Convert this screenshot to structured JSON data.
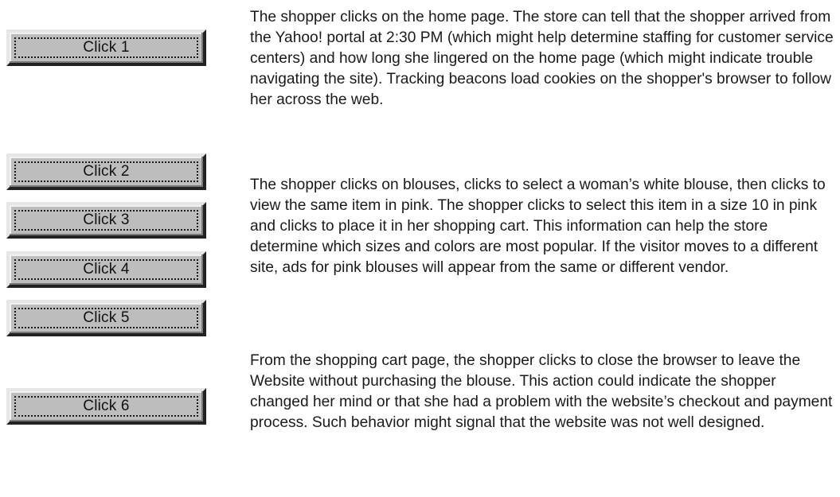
{
  "clicks": [
    {
      "label": "Click 1"
    },
    {
      "label": "Click 2"
    },
    {
      "label": "Click 3"
    },
    {
      "label": "Click 4"
    },
    {
      "label": "Click 5"
    },
    {
      "label": "Click 6"
    }
  ],
  "descriptions": [
    {
      "text": "The shopper clicks on the home page. The store can tell that the shopper arrived from the Yahoo! portal at 2:30 PM (which might help determine staffing for customer service centers) and how long she lingered on the home page (which might indicate trouble navigating the site). Tracking beacons load cookies on the shopper's browser to follow her across the web."
    },
    {
      "text": "The shopper clicks on blouses, clicks to select a woman’s white blouse, then clicks to view the same item in pink. The shopper clicks to select this item in a size 10 in pink and clicks to place it in her shopping cart. This information can help the store determine which sizes and colors are most popular. If the visitor moves to a different site, ads for pink blouses will appear from the same or different vendor."
    },
    {
      "text": "From the shopping cart page, the shopper clicks to close the browser to leave the Website without purchasing the blouse. This action could indicate the shopper changed her mind or that she had a problem with the website’s checkout and payment process. Such behavior might signal that the website was not well designed."
    }
  ]
}
